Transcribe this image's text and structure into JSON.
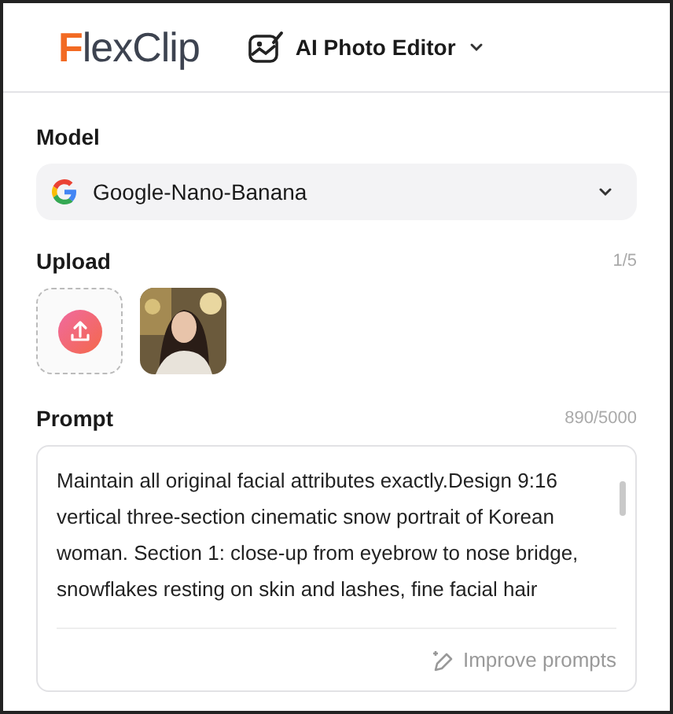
{
  "header": {
    "logo": {
      "first": "F",
      "rest": "lexClip"
    },
    "tool": "AI Photo Editor"
  },
  "model": {
    "label": "Model",
    "value": "Google-Nano-Banana"
  },
  "upload": {
    "label": "Upload",
    "count": "1/5"
  },
  "prompt": {
    "label": "Prompt",
    "count": "890/5000",
    "value": "Maintain all original facial attributes exactly.Design 9:16 vertical three-section cinematic snow portrait of Korean woman. Section 1: close-up from eyebrow to nose bridge, snowflakes resting on skin and lashes, fine facial hair",
    "action": "Improve prompts"
  }
}
